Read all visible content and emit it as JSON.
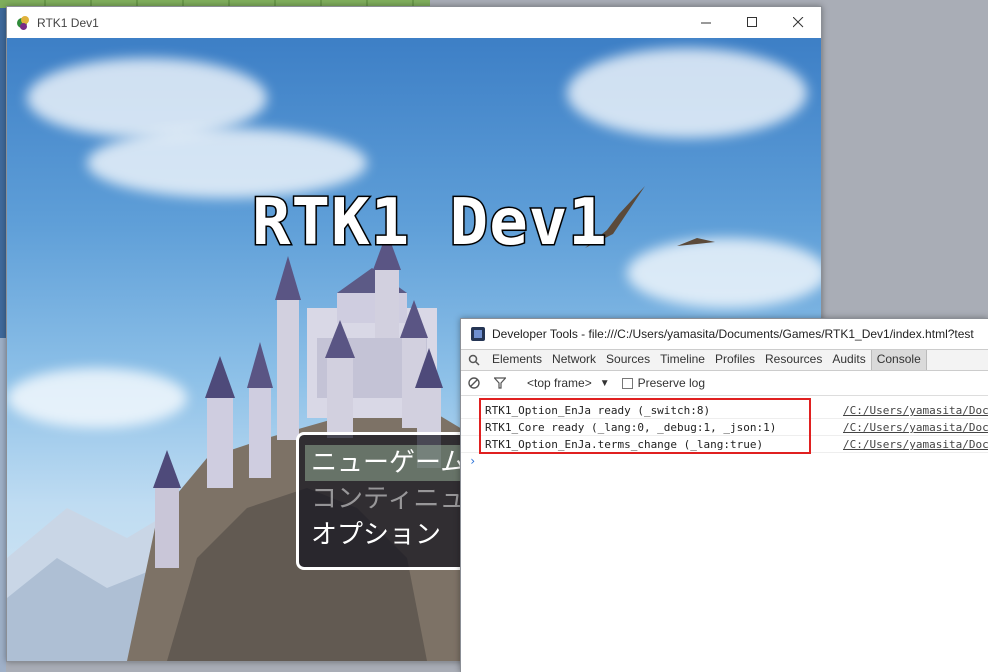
{
  "game_window": {
    "title": "RTK1 Dev1",
    "controls": {
      "minimize": "—",
      "maximize": "☐",
      "close": "✕"
    },
    "game_title": "RTK1 Dev1",
    "menu": {
      "items": [
        {
          "label": "ニューゲーム",
          "state": "selected"
        },
        {
          "label": "コンティニュー",
          "state": "disabled"
        },
        {
          "label": "オプション",
          "state": "normal"
        }
      ]
    }
  },
  "devtools": {
    "title": "Developer Tools - file:///C:/Users/yamasita/Documents/Games/RTK1_Dev1/index.html?test",
    "tabs": [
      "Elements",
      "Network",
      "Sources",
      "Timeline",
      "Profiles",
      "Resources",
      "Audits",
      "Console"
    ],
    "active_tab": "Console",
    "toolbar": {
      "frame": "<top frame>",
      "preserve_log": "Preserve log"
    },
    "console_logs": [
      {
        "text": "RTK1_Option_EnJa ready (_switch:8)",
        "source": "/C:/Users/yamasita/Doc"
      },
      {
        "text": "RTK1_Core ready (_lang:0, _debug:1, _json:1)",
        "source": "/C:/Users/yamasita/Doc"
      },
      {
        "text": "RTK1_Option_EnJa.terms_change (_lang:true)",
        "source": "/C:/Users/yamasita/Doc"
      }
    ],
    "prompt": "›"
  },
  "colors": {
    "highlight": "#e02020",
    "sky_top": "#3d7fc6"
  }
}
